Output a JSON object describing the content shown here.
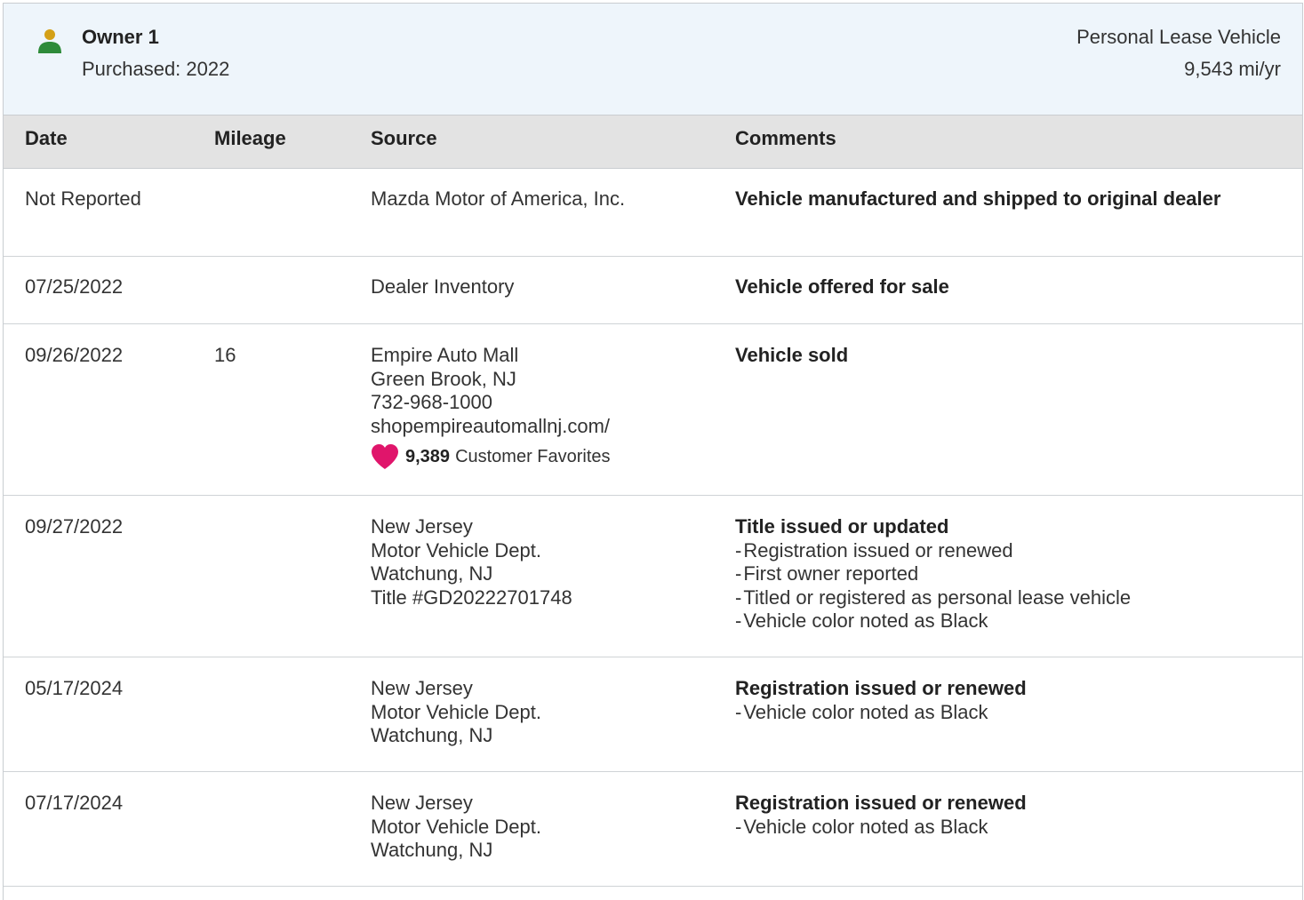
{
  "owner": {
    "name": "Owner 1",
    "purchased": "Purchased: 2022",
    "vehicle_type": "Personal Lease Vehicle",
    "miles_per_year": "9,543 mi/yr",
    "icon": "person-icon",
    "icon_colors": {
      "head": "#d4a017",
      "body": "#2e8b3a"
    }
  },
  "table": {
    "headers": {
      "date": "Date",
      "mileage": "Mileage",
      "source": "Source",
      "comments": "Comments"
    },
    "rows": [
      {
        "date": "Not Reported",
        "mileage": "",
        "source": [
          "Mazda Motor of America, Inc."
        ],
        "comment_title": "Vehicle manufactured and shipped to original dealer",
        "comment_items": []
      },
      {
        "date": "07/25/2022",
        "mileage": "",
        "source": [
          "Dealer Inventory"
        ],
        "comment_title": "Vehicle offered for sale",
        "comment_items": []
      },
      {
        "date": "09/26/2022",
        "mileage": "16",
        "source": [
          "Empire Auto Mall",
          "Green Brook, NJ",
          "732-968-1000",
          "shopempireautomallnj.com/"
        ],
        "favorites": {
          "count": "9,389",
          "label": "Customer Favorites",
          "icon": "heart-icon",
          "color": "#e0156b"
        },
        "comment_title": "Vehicle sold",
        "comment_items": []
      },
      {
        "date": "09/27/2022",
        "mileage": "",
        "source": [
          "New Jersey",
          "Motor Vehicle Dept.",
          "Watchung, NJ",
          "Title #GD20222701748"
        ],
        "comment_title": "Title issued or updated",
        "comment_items": [
          "Registration issued or renewed",
          "First owner reported",
          "Titled or registered as personal lease vehicle",
          "Vehicle color noted as Black"
        ]
      },
      {
        "date": "05/17/2024",
        "mileage": "",
        "source": [
          "New Jersey",
          "Motor Vehicle Dept.",
          "Watchung, NJ"
        ],
        "comment_title": "Registration issued or renewed",
        "comment_items": [
          "Vehicle color noted as Black"
        ]
      },
      {
        "date": "07/17/2024",
        "mileage": "",
        "source": [
          "New Jersey",
          "Motor Vehicle Dept.",
          "Watchung, NJ"
        ],
        "comment_title": "Registration issued or renewed",
        "comment_items": [
          "Vehicle color noted as Black"
        ]
      }
    ]
  }
}
